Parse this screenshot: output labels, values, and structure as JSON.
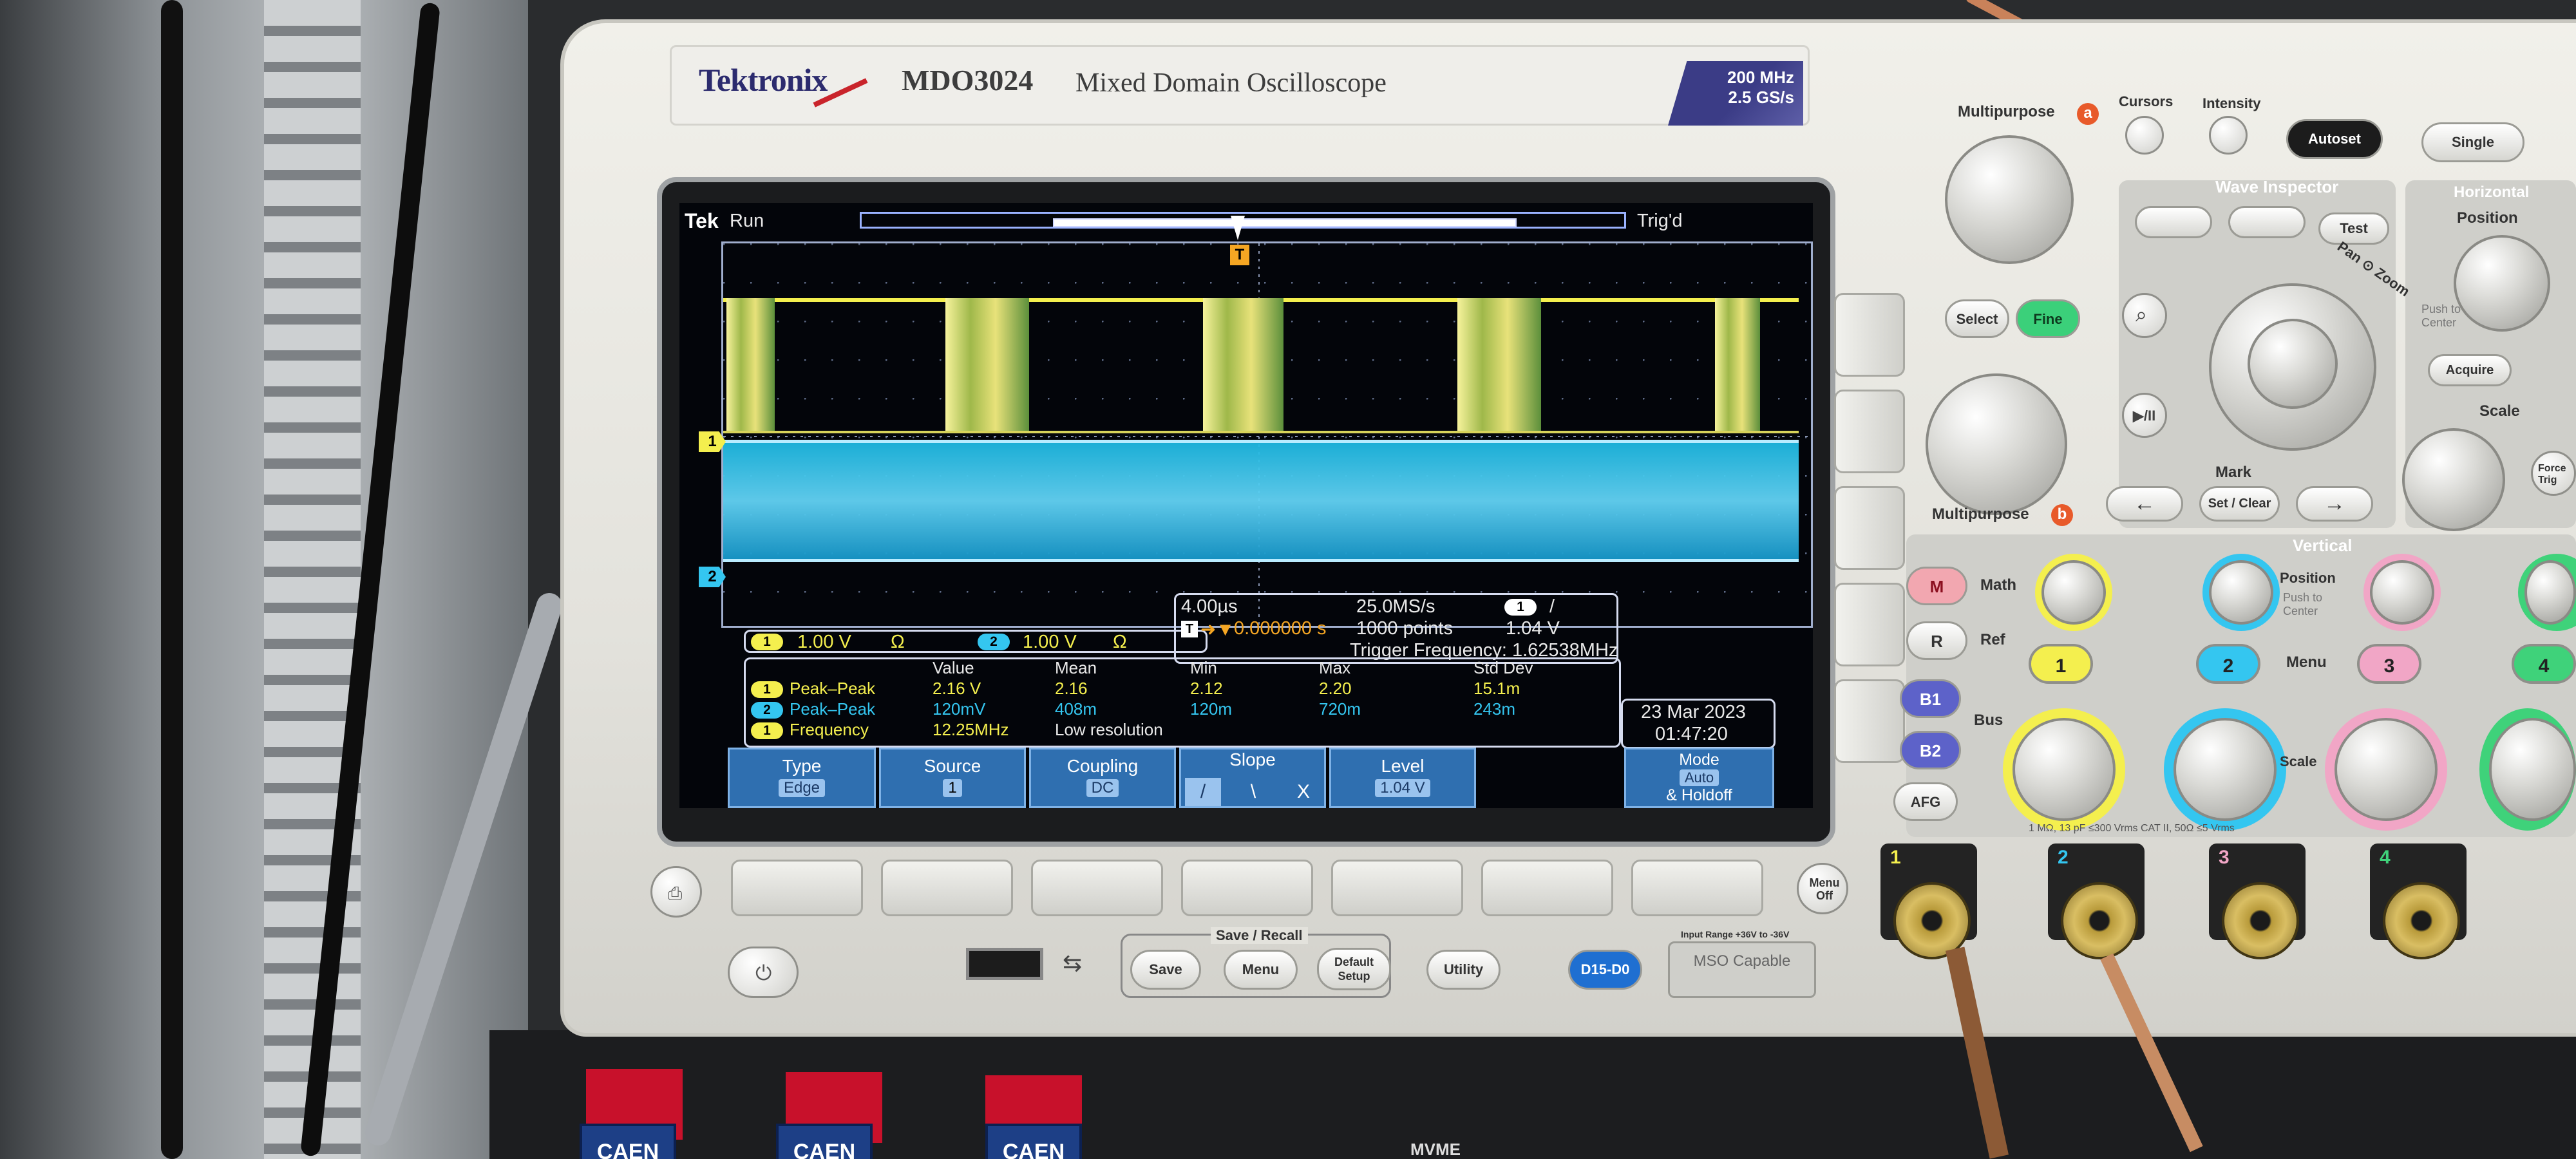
{
  "header": {
    "brand": "Tektronix",
    "model": "MDO3024",
    "model_description": "Mixed Domain Oscilloscope",
    "spec_bandwidth": "200 MHz",
    "spec_sample_rate": "2.5 GS/s"
  },
  "screen": {
    "logo": "Tek",
    "run_state": "Run",
    "trigger_state": "Trig'd",
    "trigger_marker": "T",
    "ch1_marker": "1",
    "ch2_marker": "2",
    "channel_scale": {
      "ch1_badge": "1",
      "ch1_scale": "1.00 V",
      "ch1_unit": "Ω",
      "ch2_badge": "2",
      "ch2_scale": "1.00 V",
      "ch2_unit": "Ω"
    },
    "timebase": {
      "horizontal_scale": "4.00µs",
      "sample_rate": "25.0MS/s",
      "trigger_badge": "1",
      "trigger_slope_symbol": "/",
      "position_prefix": "T",
      "position_arrow": "➜▼",
      "position_value": "0.000000 s",
      "record_length": "1000 points",
      "trigger_level": "1.04 V",
      "trigger_frequency": "Trigger Frequency: 1.62538MHz"
    },
    "measurements": {
      "headers": [
        "Value",
        "Mean",
        "Min",
        "Max",
        "Std Dev"
      ],
      "rows": [
        {
          "badge": "1",
          "name": "Peak–Peak",
          "value": "2.16 V",
          "mean": "2.16",
          "min": "2.12",
          "max": "2.20",
          "std": "15.1m"
        },
        {
          "badge": "2",
          "name": "Peak–Peak",
          "value": "120mV",
          "mean": "408m",
          "min": "120m",
          "max": "720m",
          "std": "243m"
        },
        {
          "badge": "1",
          "name": "Frequency",
          "value": "12.25MHz",
          "note": "Low resolution"
        }
      ]
    },
    "datetime": {
      "date": "23 Mar 2023",
      "time": "01:47:20"
    },
    "menu": {
      "type_label": "Type",
      "type_value": "Edge",
      "source_label": "Source",
      "source_value": "1",
      "coupling_label": "Coupling",
      "coupling_value": "DC",
      "slope_label": "Slope",
      "slope_rising": "/",
      "slope_falling": "\\",
      "slope_both": "X",
      "level_label": "Level",
      "level_value": "1.04 V",
      "mode_label": "Mode",
      "mode_value": "Auto",
      "mode_sub": "& Holdoff"
    }
  },
  "front_panel": {
    "multipurpose_a": "Multipurpose",
    "multipurpose_a_letter": "a",
    "multipurpose_b": "Multipurpose",
    "multipurpose_b_letter": "b",
    "cursors": "Cursors",
    "intensity": "Intensity",
    "autoset": "Autoset",
    "single": "Single",
    "select": "Select",
    "fine": "Fine",
    "wave_inspector": "Wave Inspector",
    "test": "Test",
    "pan_zoom": "Pan ⊙ Zoom",
    "mark": "Mark",
    "set_clear": "Set / Clear",
    "prev_arrow": "←",
    "next_arrow": "→",
    "play_pause": "▶/II",
    "horizontal": "Horizontal",
    "position": "Position",
    "push_center": "Push to Center",
    "acquire": "Acquire",
    "scale": "Scale",
    "force_trig": "Force Trig",
    "vertical": "Vertical",
    "math": "Math",
    "math_letter": "M",
    "ref": "Ref",
    "ref_letter": "R",
    "b1": "B1",
    "b2": "B2",
    "bus": "Bus",
    "afg": "AFG",
    "menu": "Menu",
    "vpos": "Position",
    "vpush_center": "Push to Center",
    "vscale": "Scale",
    "ch_buttons": [
      "1",
      "2",
      "3",
      "4"
    ],
    "input_spec": "1 MΩ, 13 pF ≤300 Vrms CAT II, 50Ω ≤5 Vrms",
    "save_recall": "Save / Recall",
    "save": "Save",
    "recall_menu": "Menu",
    "default_setup": "Default Setup",
    "utility": "Utility",
    "digital": "D15-D0",
    "mso_capable": "MSO Capable",
    "input_range": "Input Range +36V to -36V",
    "menu_off": "Menu Off"
  },
  "crate": {
    "labels": [
      "CAEN",
      "CAEN",
      "CAEN"
    ],
    "mvme": "MVME"
  }
}
